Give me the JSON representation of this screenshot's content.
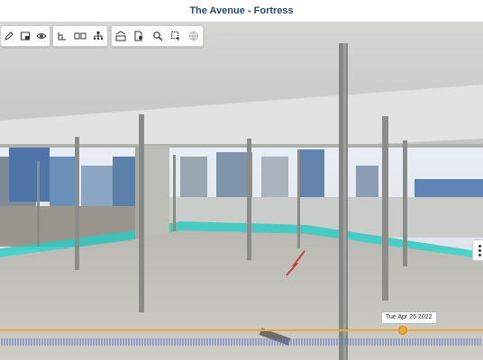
{
  "window": {
    "title": "The Avenue - Fortress"
  },
  "toolbar_groups": [
    {
      "name": "annotate-group",
      "buttons": [
        "pencil-icon",
        "layers-icon",
        "eye-icon"
      ]
    },
    {
      "name": "navigate-group",
      "buttons": [
        "floorplan-icon",
        "split-view-icon",
        "hierarchy-icon"
      ]
    },
    {
      "name": "tools-group",
      "buttons": [
        "bim-icon",
        "document-settings-icon",
        "search-icon",
        "select-area-icon",
        "globe-icon"
      ]
    }
  ],
  "timeline": {
    "current_date": "Tue Apr 26 2022",
    "accent": "#f0a830",
    "tick_color": "#5b7bc9"
  },
  "side_menu": {
    "icon": "more-vertical-icon"
  }
}
